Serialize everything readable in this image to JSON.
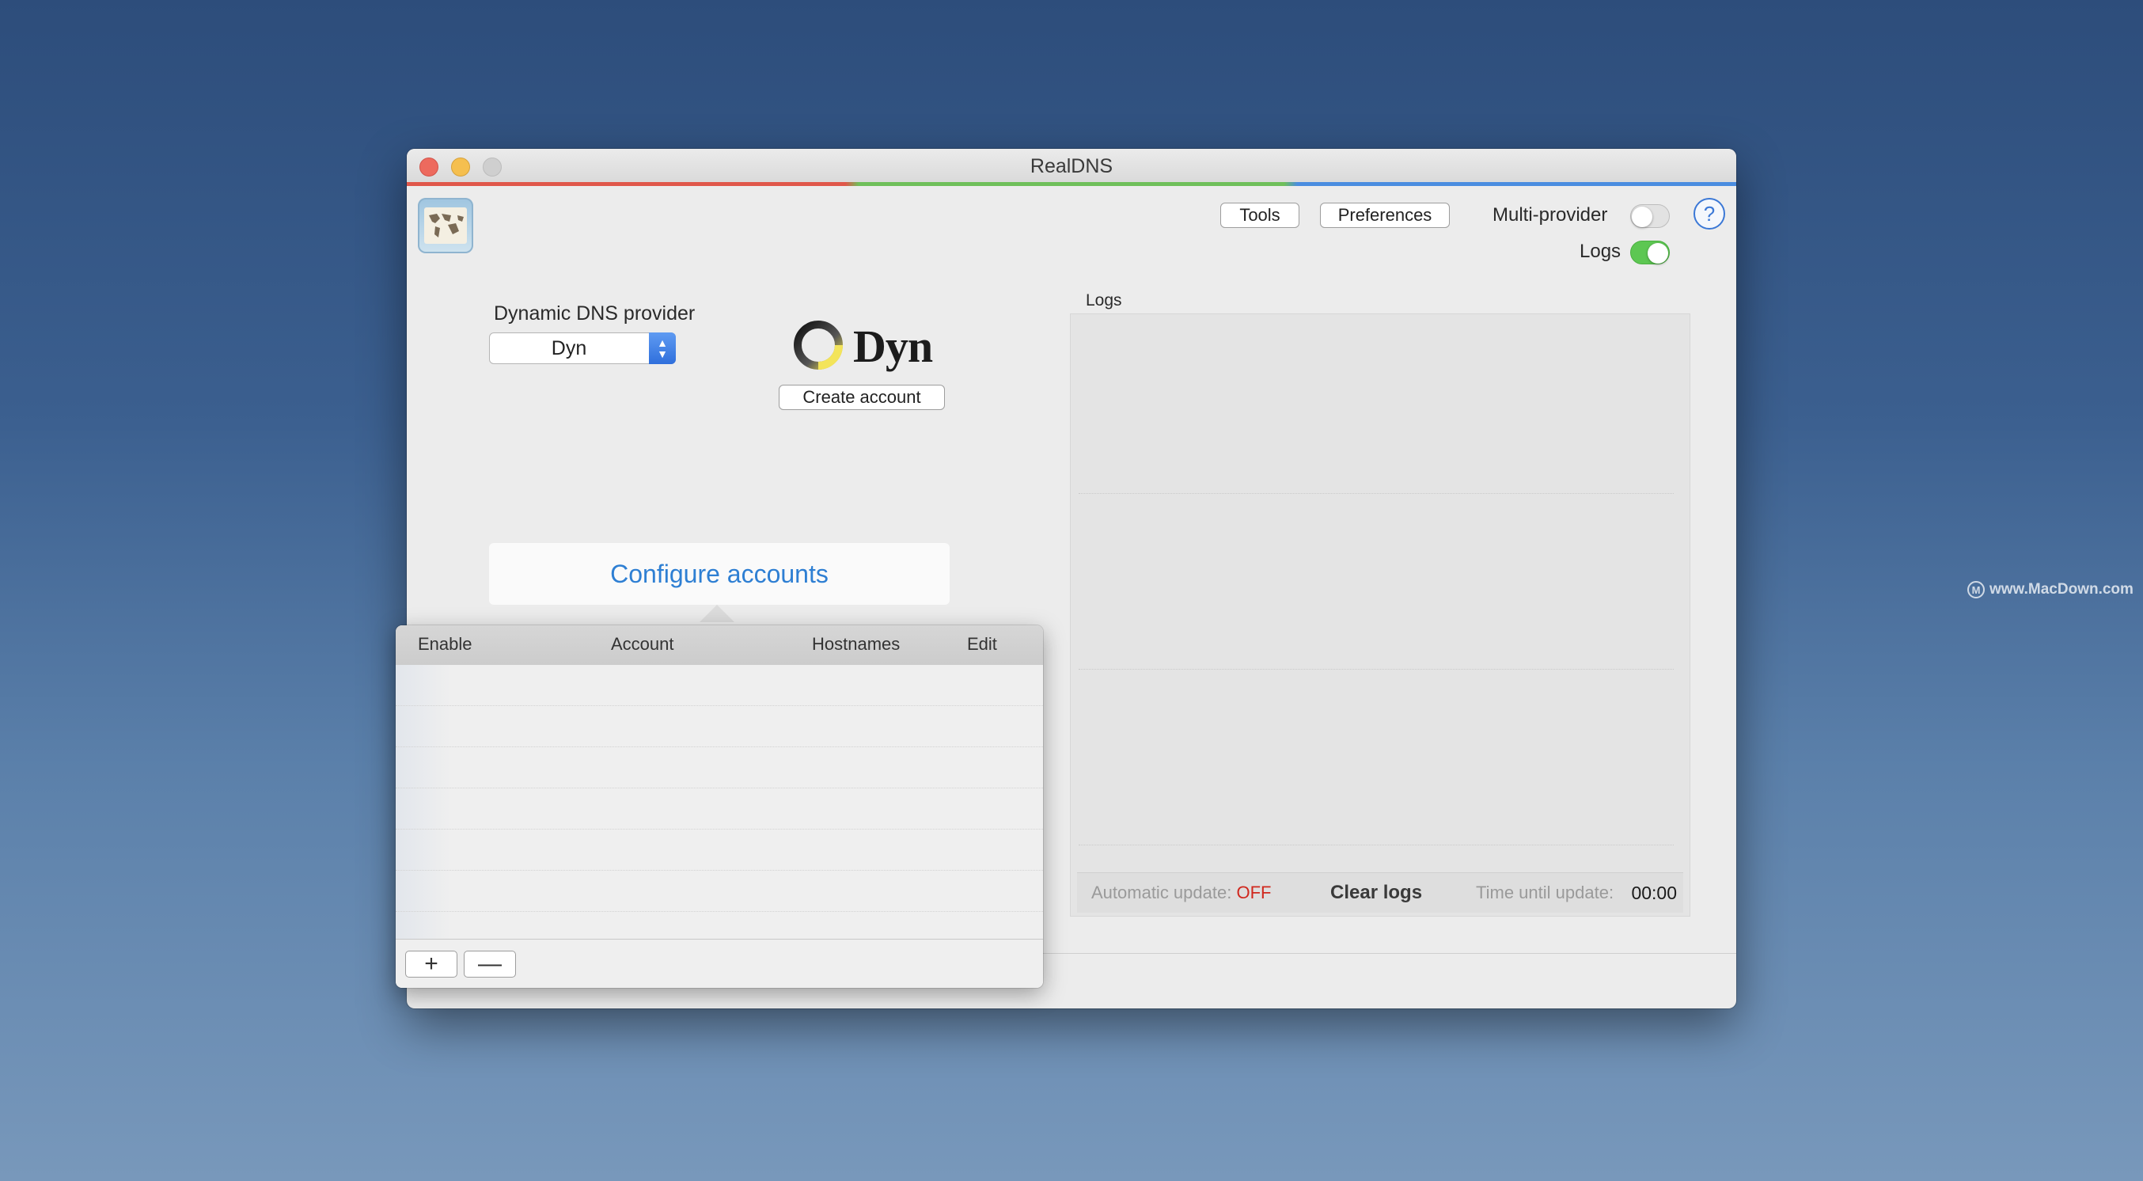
{
  "window": {
    "title": "RealDNS"
  },
  "toolbar": {
    "tools_label": "Tools",
    "preferences_label": "Preferences",
    "multi_provider_label": "Multi-provider",
    "multi_provider_on": false,
    "logs_label": "Logs",
    "logs_on": true,
    "help_symbol": "?"
  },
  "provider": {
    "heading": "Dynamic DNS provider",
    "selected": "Dyn",
    "logo_text": "Dyn",
    "create_account_label": "Create account"
  },
  "configure_label": "Configure accounts",
  "accounts_table": {
    "columns": [
      "Enable",
      "Account",
      "Hostnames",
      "Edit"
    ],
    "rows": [],
    "add_symbol": "+",
    "remove_symbol": "—"
  },
  "logs": {
    "title": "Logs",
    "auto_update_label": "Automatic update:",
    "auto_update_value": "OFF",
    "clear_label": "Clear logs",
    "time_until_label": "Time until update:",
    "time_until_value": "00:00"
  },
  "watermark": "www.MacDown.com",
  "colors": {
    "accent": "#2e7fd3",
    "off": "#d0281e",
    "toggle_on": "#5dc752"
  }
}
